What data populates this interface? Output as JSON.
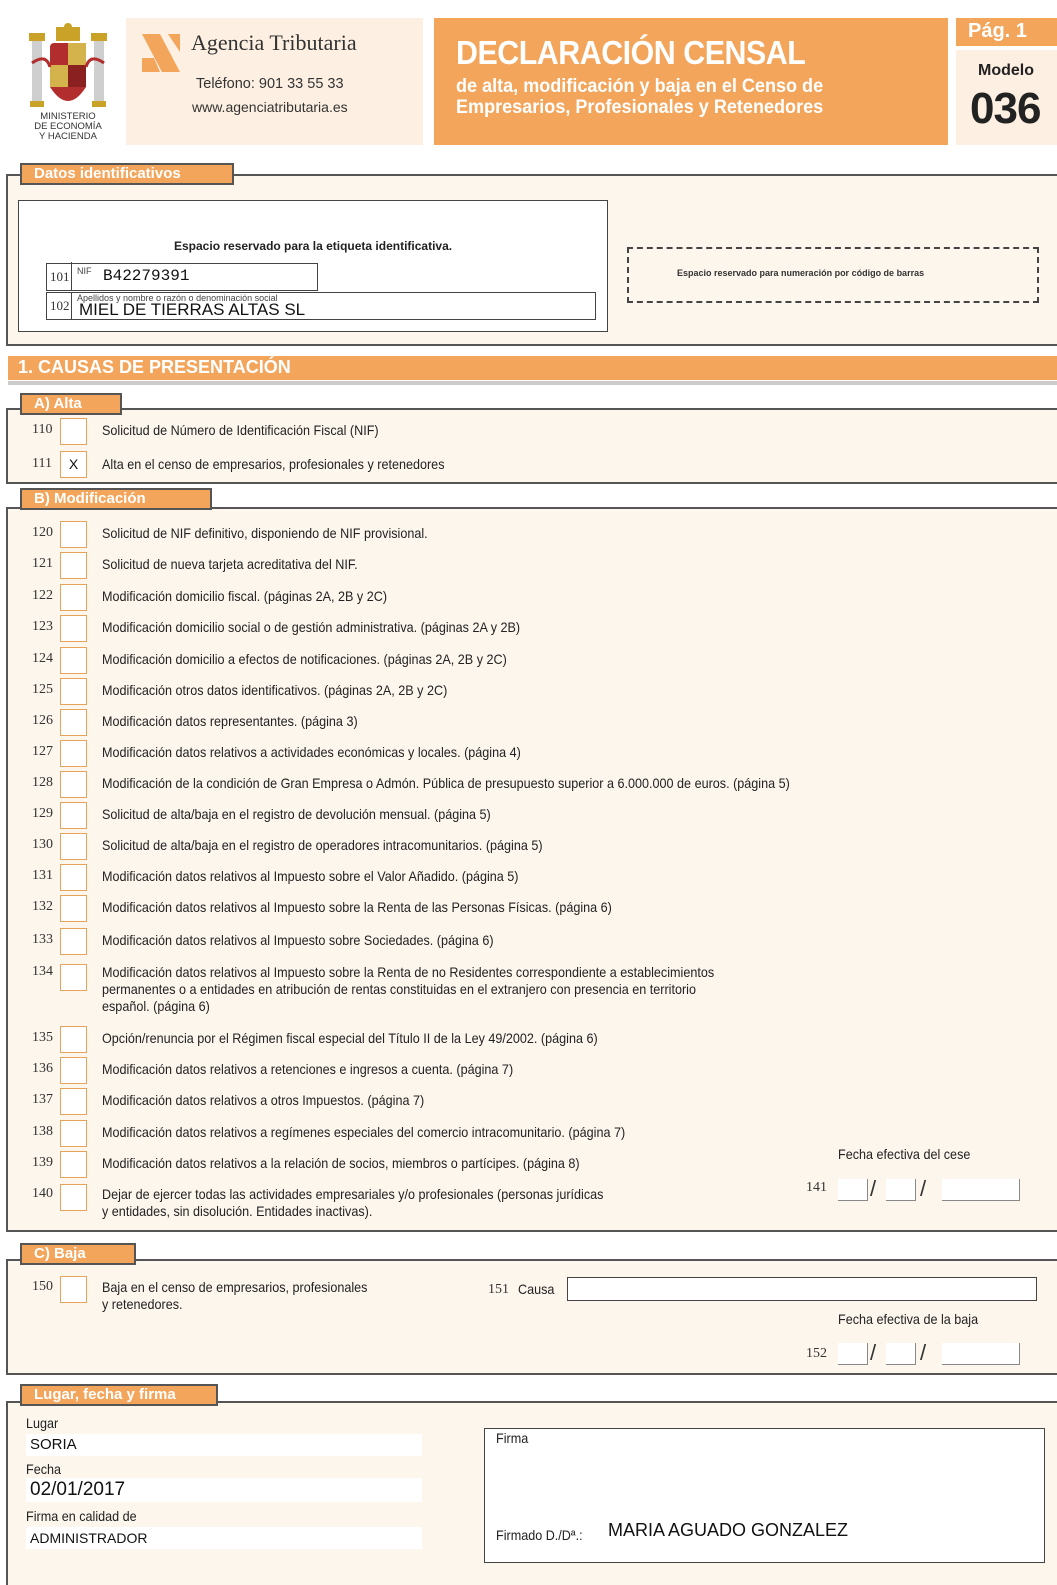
{
  "header": {
    "ministry_line1": "MINISTERIO",
    "ministry_line2": "DE ECONOMÍA",
    "ministry_line3": "Y HACIENDA",
    "agency_name": "Agencia Tributaria",
    "agency_phone": "Teléfono: 901 33 55 33",
    "agency_web": "www.agenciatributaria.es",
    "title": "DECLARACIÓN CENSAL",
    "subtitle": "de alta, modificación y baja en el Censo de Empresarios, Profesionales y Retenedores",
    "page_label": "Pág. 1",
    "modelo_label": "Modelo",
    "modelo_number": "036"
  },
  "identification": {
    "tab_title": "Datos identificativos",
    "reserved_label": "Espacio reservado para la etiqueta identificativa.",
    "nif_num": "101",
    "nif_caption": "NIF",
    "nif_value": "B42279391",
    "name_num": "102",
    "name_caption": "Apellidos y nombre o razón o denominación social",
    "name_value": "MIEL DE TIERRAS ALTAS SL",
    "barcode_label": "Espacio reservado para numeración por código de barras"
  },
  "section1": {
    "title": "1. CAUSAS DE PRESENTACIÓN",
    "alta": {
      "tab": "A) Alta",
      "items": [
        {
          "num": "110",
          "checked": "",
          "text": "Solicitud de Número de Identificación Fiscal (NIF)"
        },
        {
          "num": "111",
          "checked": "X",
          "text": "Alta en el censo de empresarios, profesionales y retenedores"
        }
      ]
    },
    "modificacion": {
      "tab": "B) Modificación",
      "items": [
        {
          "num": "120",
          "text": "Solicitud de NIF definitivo, disponiendo de NIF provisional."
        },
        {
          "num": "121",
          "text": "Solicitud de nueva tarjeta acreditativa del NIF."
        },
        {
          "num": "122",
          "text": "Modificación domicilio fiscal. (páginas 2A, 2B y 2C)"
        },
        {
          "num": "123",
          "text": "Modificación domicilio social o de gestión administrativa. (páginas 2A y 2B)"
        },
        {
          "num": "124",
          "text": "Modificación domicilio a efectos de notificaciones. (páginas 2A, 2B y 2C)"
        },
        {
          "num": "125",
          "text": "Modificación otros datos identificativos. (páginas 2A, 2B y 2C)"
        },
        {
          "num": "126",
          "text": "Modificación datos representantes. (página 3)"
        },
        {
          "num": "127",
          "text": "Modificación datos relativos a actividades económicas y locales. (página 4)"
        },
        {
          "num": "128",
          "text": "Modificación de la condición de Gran Empresa o Admón. Pública de presupuesto superior a 6.000.000 de euros. (página 5)"
        },
        {
          "num": "129",
          "text": "Solicitud de alta/baja en el registro de devolución mensual. (página 5)"
        },
        {
          "num": "130",
          "text": "Solicitud de alta/baja en el registro de operadores intracomunitarios. (página 5)"
        },
        {
          "num": "131",
          "text": "Modificación datos relativos al Impuesto sobre el Valor Añadido. (página 5)"
        },
        {
          "num": "132",
          "text": "Modificación datos relativos al Impuesto sobre la Renta de las Personas Físicas. (página 6)"
        },
        {
          "num": "133",
          "text": "Modificación datos relativos al Impuesto sobre Sociedades. (página 6)"
        },
        {
          "num": "134",
          "text1": "Modificación datos relativos al Impuesto sobre la Renta de no Residentes correspondiente a establecimientos",
          "text2": "permanentes o a entidades en atribución de rentas constituidas en el extranjero con presencia en territorio",
          "text3": "español. (página 6)"
        },
        {
          "num": "135",
          "text": "Opción/renuncia por el Régimen fiscal especial del Título II de la Ley 49/2002. (página 6)"
        },
        {
          "num": "136",
          "text": "Modificación datos relativos a retenciones e ingresos a cuenta. (página 7)"
        },
        {
          "num": "137",
          "text": "Modificación datos relativos a otros Impuestos. (página 7)"
        },
        {
          "num": "138",
          "text": "Modificación datos relativos a regímenes especiales del comercio intracomunitario. (página 7)"
        },
        {
          "num": "139",
          "text": "Modificación datos relativos a la relación de socios, miembros o partícipes. (página 8)"
        },
        {
          "num": "140",
          "text1": "Dejar de ejercer todas las actividades empresariales y/o profesionales (personas jurídicas",
          "text2": "y entidades, sin disolución. Entidades inactivas)."
        }
      ],
      "cese_label": "Fecha efectiva del cese",
      "cese_num": "141"
    },
    "baja": {
      "tab": "C) Baja",
      "num": "150",
      "text1": "Baja en el censo de empresarios, profesionales",
      "text2": "y retenedores.",
      "causa_num": "151",
      "causa_label": "Causa",
      "causa_value": "",
      "fecha_label": "Fecha efectiva de la baja",
      "fecha_num": "152"
    }
  },
  "firma": {
    "tab": "Lugar, fecha y firma",
    "lugar_label": "Lugar",
    "lugar_value": "SORIA",
    "fecha_label": "Fecha",
    "fecha_value": "02/01/2017",
    "calidad_label": "Firma en calidad de",
    "calidad_value": "ADMINISTRADOR",
    "firma_label": "Firma",
    "firmado_label": "Firmado D./Dª.:",
    "firmado_value": "MARIA AGUADO GONZALEZ"
  },
  "colors": {
    "accent": "#f4a55c",
    "panel_bg": "#fdf6ed",
    "header_bg": "#fdf0e2"
  }
}
